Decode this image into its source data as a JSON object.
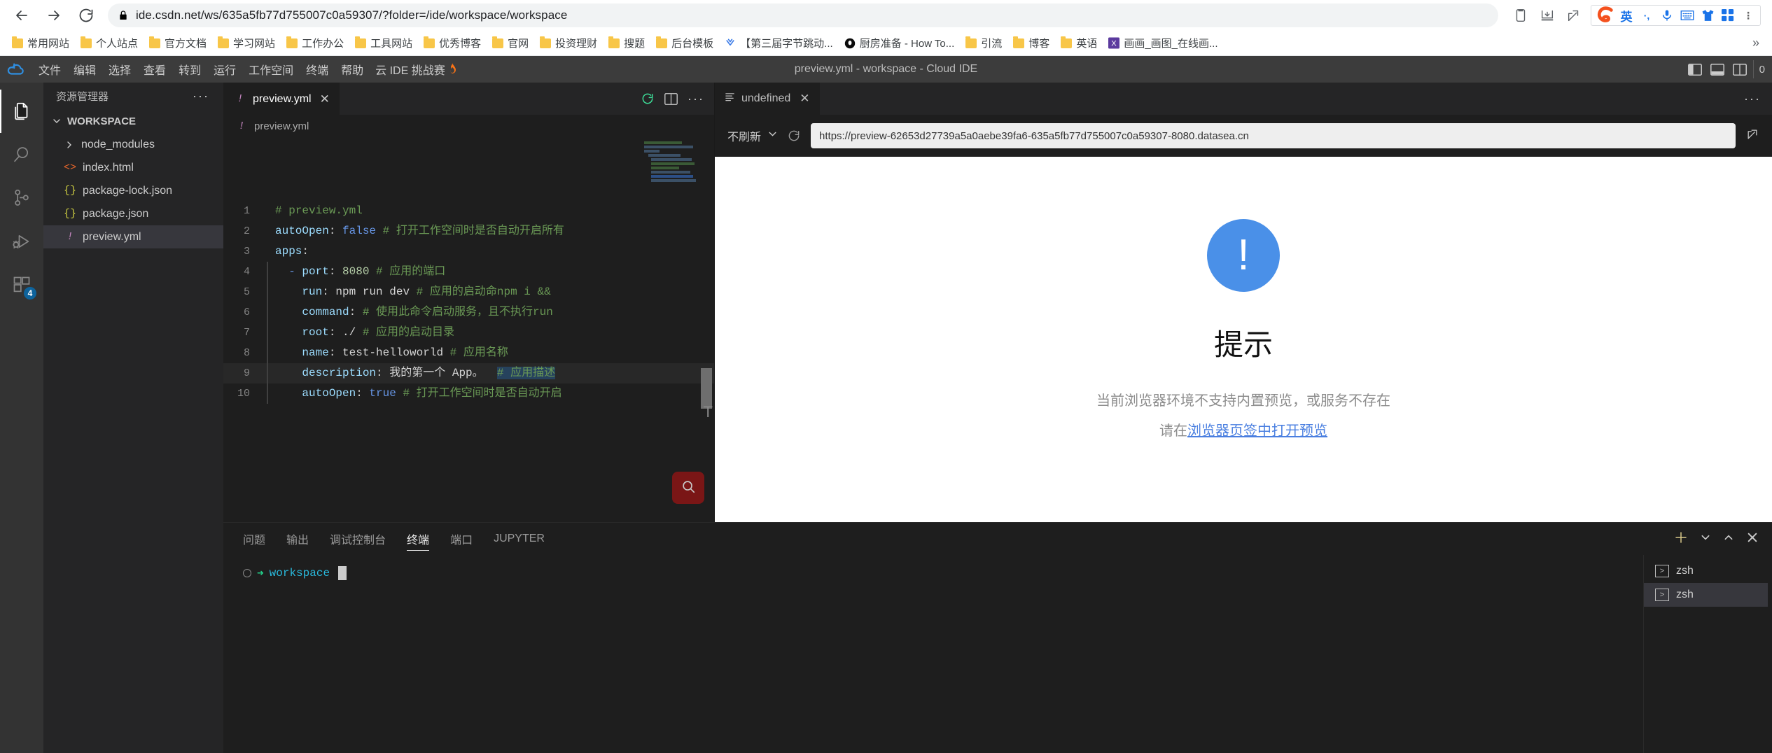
{
  "browser": {
    "nav": {
      "back_icon": "arrow-left-icon",
      "forward_icon": "arrow-right-icon",
      "reload_icon": "reload-icon",
      "lock_icon": "lock-icon"
    },
    "url": "ide.csdn.net/ws/635a5fb77d755007c0a59307/?folder=/ide/workspace/workspace",
    "toolbar_icons": [
      "clipboard-icon",
      "download-icon",
      "share-icon"
    ],
    "ime": {
      "logo": "sogou-logo-icon",
      "mode": "英",
      "punct": "·,",
      "mic": "microphone-icon",
      "keyboard": "keyboard-icon",
      "skin": "tshirt-icon",
      "apps": "apps-grid-icon",
      "more": "more-vertical-icon"
    },
    "bookmarks": [
      {
        "label": "常用网站",
        "icon": "folder-icon"
      },
      {
        "label": "个人站点",
        "icon": "folder-icon"
      },
      {
        "label": "官方文档",
        "icon": "folder-icon"
      },
      {
        "label": "学习网站",
        "icon": "folder-icon"
      },
      {
        "label": "工作办公",
        "icon": "folder-icon"
      },
      {
        "label": "工具网站",
        "icon": "folder-icon"
      },
      {
        "label": "优秀博客",
        "icon": "folder-icon"
      },
      {
        "label": "官网",
        "icon": "folder-icon"
      },
      {
        "label": "投资理财",
        "icon": "folder-icon"
      },
      {
        "label": "搜题",
        "icon": "folder-icon"
      },
      {
        "label": "后台模板",
        "icon": "folder-icon"
      },
      {
        "label": "【第三届字节跳动...",
        "icon": "doubao-icon"
      },
      {
        "label": "厨房准备 - How To...",
        "icon": "black-circle-icon"
      },
      {
        "label": "引流",
        "icon": "folder-icon"
      },
      {
        "label": "博客",
        "icon": "folder-icon"
      },
      {
        "label": "英语",
        "icon": "folder-icon"
      },
      {
        "label": "画画_画图_在线画...",
        "icon": "purple-x-icon"
      }
    ],
    "bookmarks_overflow": "»"
  },
  "ide": {
    "window_title": "preview.yml - workspace - Cloud IDE",
    "logo": "cloud-ide-logo-icon",
    "menu": [
      "文件",
      "编辑",
      "选择",
      "查看",
      "转到",
      "运行",
      "工作空间",
      "终端",
      "帮助"
    ],
    "challenge_label": "云 IDE 挑战赛",
    "challenge_icon": "flame-icon",
    "layout_icons": [
      "toggle-sidebar-icon",
      "toggle-panel-icon",
      "toggle-secondary-sidebar-icon",
      "customize-layout-icon"
    ],
    "activity_bar": [
      {
        "name": "explorer",
        "icon": "files-icon",
        "active": true,
        "badge": ""
      },
      {
        "name": "search",
        "icon": "search-icon",
        "active": false,
        "badge": ""
      },
      {
        "name": "source-control",
        "icon": "source-control-icon",
        "active": false,
        "badge": ""
      },
      {
        "name": "run-debug",
        "icon": "run-debug-icon",
        "active": false,
        "badge": ""
      },
      {
        "name": "extensions",
        "icon": "extensions-icon",
        "active": false,
        "badge": "4"
      }
    ],
    "sidebar": {
      "title": "资源管理器",
      "more_icon": "more-horizontal-icon",
      "root": "WORKSPACE",
      "files": [
        {
          "label": "node_modules",
          "icon": "chevron-right-icon",
          "kind": "folder",
          "selected": false
        },
        {
          "label": "index.html",
          "icon": "html-icon",
          "kind": "file",
          "selected": false
        },
        {
          "label": "package-lock.json",
          "icon": "json-icon",
          "kind": "file",
          "selected": false
        },
        {
          "label": "package.json",
          "icon": "json-icon",
          "kind": "file",
          "selected": false
        },
        {
          "label": "preview.yml",
          "icon": "yaml-icon",
          "kind": "file",
          "selected": true
        }
      ]
    },
    "editor": {
      "tab": {
        "label": "preview.yml",
        "icon": "yaml-icon",
        "close": "✕"
      },
      "actions": [
        "restart-preview-icon",
        "split-editor-icon",
        "more-actions-icon"
      ],
      "breadcrumb": {
        "icon": "yaml-icon",
        "label": "preview.yml"
      },
      "find_icon": "search-icon",
      "lines": [
        {
          "n": "1",
          "guide": false,
          "cur": false,
          "segments": [
            {
              "t": "# preview.yml",
              "c": "k-comment"
            }
          ]
        },
        {
          "n": "2",
          "guide": false,
          "cur": false,
          "segments": [
            {
              "t": "autoOpen",
              "c": "k-key"
            },
            {
              "t": ": ",
              "c": "k-punct"
            },
            {
              "t": "false",
              "c": "k-dash"
            },
            {
              "t": " ",
              "c": "k-punct"
            },
            {
              "t": "# 打开工作空间时是否自动开启所有",
              "c": "k-comment"
            }
          ]
        },
        {
          "n": "3",
          "guide": false,
          "cur": false,
          "segments": [
            {
              "t": "apps",
              "c": "k-key"
            },
            {
              "t": ":",
              "c": "k-punct"
            }
          ]
        },
        {
          "n": "4",
          "guide": true,
          "cur": false,
          "segments": [
            {
              "t": "  - ",
              "c": "k-dash"
            },
            {
              "t": "port",
              "c": "k-key"
            },
            {
              "t": ": ",
              "c": "k-punct"
            },
            {
              "t": "8080",
              "c": "k-num"
            },
            {
              "t": " ",
              "c": "k-punct"
            },
            {
              "t": "# 应用的端口",
              "c": "k-comment"
            }
          ]
        },
        {
          "n": "5",
          "guide": true,
          "cur": false,
          "segments": [
            {
              "t": "    ",
              "c": "k-punct"
            },
            {
              "t": "run",
              "c": "k-key"
            },
            {
              "t": ": ",
              "c": "k-punct"
            },
            {
              "t": "npm run dev",
              "c": "k-punct"
            },
            {
              "t": " ",
              "c": "k-punct"
            },
            {
              "t": "# 应用的启动命npm i &&",
              "c": "k-comment"
            }
          ]
        },
        {
          "n": "6",
          "guide": true,
          "cur": false,
          "segments": [
            {
              "t": "    ",
              "c": "k-punct"
            },
            {
              "t": "command",
              "c": "k-key"
            },
            {
              "t": ": ",
              "c": "k-punct"
            },
            {
              "t": "# 使用此命令启动服务，且不执行run",
              "c": "k-comment"
            }
          ]
        },
        {
          "n": "7",
          "guide": true,
          "cur": false,
          "segments": [
            {
              "t": "    ",
              "c": "k-punct"
            },
            {
              "t": "root",
              "c": "k-key"
            },
            {
              "t": ": ",
              "c": "k-punct"
            },
            {
              "t": "./",
              "c": "k-punct"
            },
            {
              "t": " ",
              "c": "k-punct"
            },
            {
              "t": "# 应用的启动目录",
              "c": "k-comment"
            }
          ]
        },
        {
          "n": "8",
          "guide": true,
          "cur": false,
          "segments": [
            {
              "t": "    ",
              "c": "k-punct"
            },
            {
              "t": "name",
              "c": "k-key"
            },
            {
              "t": ": ",
              "c": "k-punct"
            },
            {
              "t": "test-helloworld",
              "c": "k-punct"
            },
            {
              "t": " ",
              "c": "k-punct"
            },
            {
              "t": "# 应用名称",
              "c": "k-comment"
            }
          ]
        },
        {
          "n": "9",
          "guide": true,
          "cur": true,
          "segments": [
            {
              "t": "    ",
              "c": "k-punct"
            },
            {
              "t": "description",
              "c": "k-key"
            },
            {
              "t": ": ",
              "c": "k-punct"
            },
            {
              "t": "我的第一个 App。",
              "c": "k-punct"
            },
            {
              "t": "  ",
              "c": "k-punct"
            },
            {
              "t": "# 应用描述",
              "c": "k-comment hl-sel"
            }
          ]
        },
        {
          "n": "10",
          "guide": true,
          "cur": false,
          "segments": [
            {
              "t": "    ",
              "c": "k-punct"
            },
            {
              "t": "autoOpen",
              "c": "k-key"
            },
            {
              "t": ": ",
              "c": "k-punct"
            },
            {
              "t": "true",
              "c": "k-dash"
            },
            {
              "t": " ",
              "c": "k-punct"
            },
            {
              "t": "# 打开工作空间时是否自动开启",
              "c": "k-comment"
            }
          ]
        }
      ]
    },
    "preview": {
      "tab": {
        "label": "undefined",
        "icon": "preview-list-icon",
        "close": "✕"
      },
      "more_icon": "more-horizontal-icon",
      "refresh_mode": "不刷新",
      "dropdown_icon": "chevron-down-icon",
      "reload_icon": "reload-icon",
      "url": "https://preview-62653d27739a5a0aebe39fa6-635a5fb77d755007c0a59307-8080.datasea.cn",
      "open_external_icon": "open-external-icon",
      "content": {
        "icon_glyph": "!",
        "icon_color": "#4a90e8",
        "title": "提示",
        "message": "当前浏览器环境不支持内置预览，或服务不存在",
        "sub_prefix": "请在",
        "link": "浏览器页签中打开预览"
      }
    },
    "panel": {
      "tabs": [
        {
          "label": "问题",
          "active": false
        },
        {
          "label": "输出",
          "active": false
        },
        {
          "label": "调试控制台",
          "active": false
        },
        {
          "label": "终端",
          "active": true
        },
        {
          "label": "端口",
          "active": false
        },
        {
          "label": "JUPYTER",
          "active": false
        }
      ],
      "actions": [
        "add-terminal-icon",
        "split-terminal-dropdown-icon",
        "maximize-panel-icon",
        "close-panel-icon"
      ],
      "terminal": {
        "status_glyph": "○",
        "arrow": "➜",
        "path": "workspace",
        "cursor": ""
      },
      "terminal_list": [
        {
          "label": "zsh",
          "icon": "terminal-icon",
          "active": false
        },
        {
          "label": "zsh",
          "icon": "terminal-icon",
          "active": true
        }
      ]
    }
  },
  "colors": {
    "accent_blue": "#4a90e8",
    "terminal_green": "#23d18b",
    "terminal_cyan": "#29b8db",
    "comment_green": "#6a9955",
    "key_blue": "#9cdcfe",
    "number_green": "#b5cea8",
    "bookmark_yellow": "#f8c648",
    "find_red": "#7a1616",
    "badge_blue": "#0e639c"
  }
}
